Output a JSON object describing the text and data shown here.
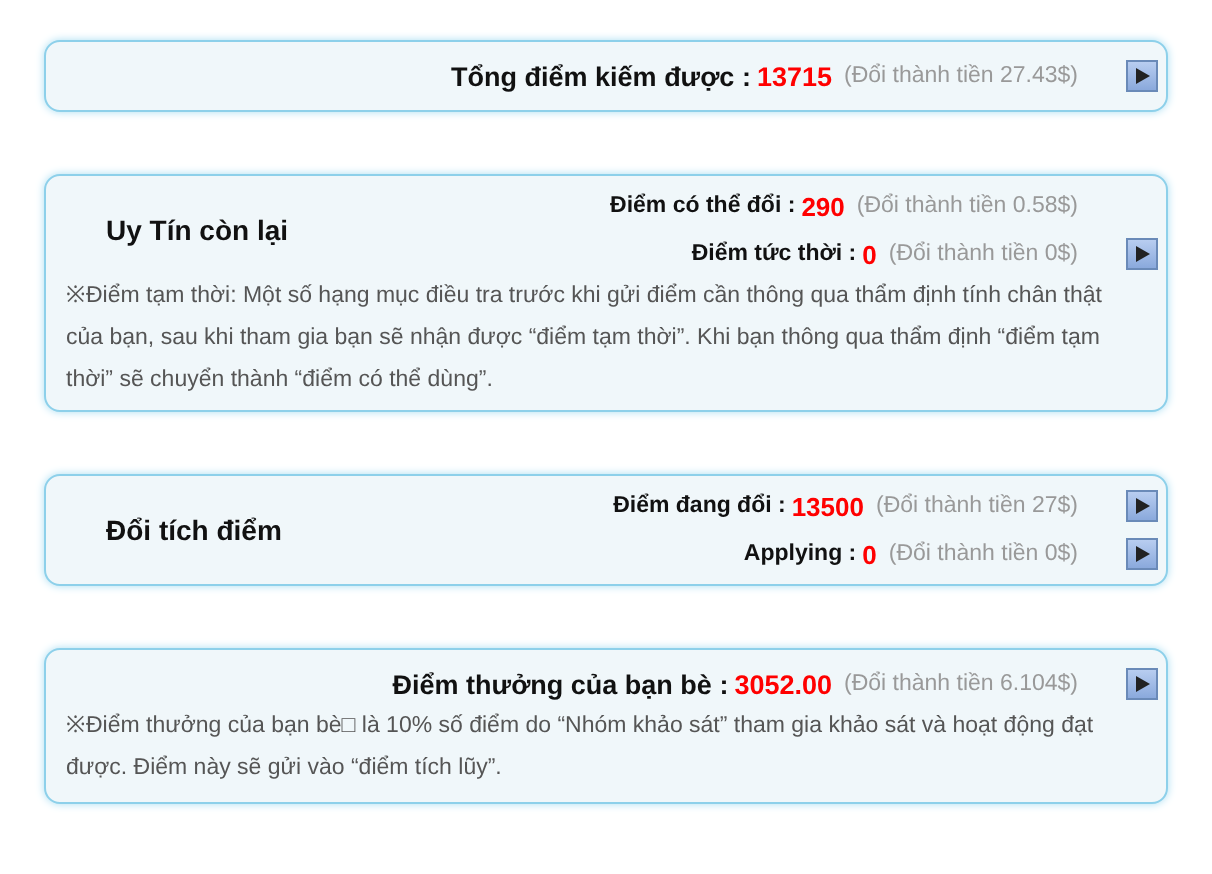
{
  "cards": [
    {
      "kind": "total",
      "rows": [
        {
          "label": "Tổng điểm kiếm được :",
          "value": "13715",
          "money": "(Đổi thành tiền 27.43$)",
          "arrow": true
        }
      ]
    },
    {
      "kind": "group",
      "title": "Uy Tín còn lại",
      "rows": [
        {
          "label": "Điểm có thể đổi :",
          "value": "290",
          "money": "(Đổi thành tiền 0.58$)",
          "arrow": false
        },
        {
          "label": "Điểm tức thời :",
          "value": "0",
          "money": "(Đổi thành tiền 0$)",
          "arrow": true
        }
      ],
      "note": "※Điểm tạm thời: Một số hạng mục điều tra trước khi gửi điểm cần thông qua thẩm định tính chân thật của bạn, sau khi tham gia bạn sẽ nhận được “điểm tạm thời”. Khi bạn thông qua thẩm định “điểm tạm thời” sẽ chuyển thành “điểm có thể dùng”."
    },
    {
      "kind": "group",
      "title": "Đổi tích điểm",
      "rows": [
        {
          "label": "Điểm đang đổi :",
          "value": "13500",
          "money": "(Đổi thành tiền 27$)",
          "arrow": true
        },
        {
          "label": "Applying :",
          "value": "0",
          "money": "(Đổi thành tiền 0$)",
          "arrow": true
        }
      ]
    },
    {
      "kind": "total",
      "rows": [
        {
          "label": "Điểm thưởng của bạn bè :",
          "value": "3052.00",
          "money": "(Đổi thành tiền 6.104$)",
          "arrow": true
        }
      ],
      "note": "※Điểm thưởng của bạn bè□ là 10% số điểm do “Nhóm khảo sát” tham gia khảo sát và hoạt động đạt được. Điểm này sẽ gửi vào “điểm tích lũy”."
    }
  ]
}
